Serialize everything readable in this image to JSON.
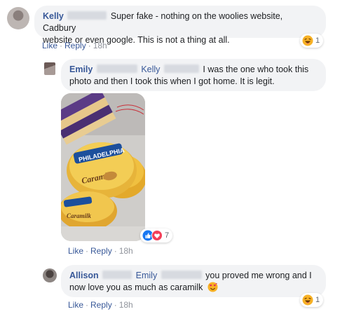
{
  "comments": [
    {
      "author": "Kelly",
      "text": "Super fake - nothing on the woolies website, Cadbury website or even google. This is not a thing at all.",
      "text_line1": "Super fake - nothing on the woolies website, Cadbury",
      "text_line2": "website or even google. This is not a thing at all.",
      "reaction": {
        "icon": "haha-emoji-icon",
        "count": "1"
      },
      "actions": {
        "like": "Like",
        "reply": "Reply",
        "time": "18h"
      }
    },
    {
      "author": "Emily",
      "mention": "Kelly",
      "text_line1": "I was the one who took this",
      "text_line2": "photo and then I took this when I got home. It is legit.",
      "photo_reactions": {
        "icons": [
          "like-icon",
          "love-icon"
        ],
        "count": "7"
      },
      "photo_label": "PHILADELPHIA Caramilk",
      "actions": {
        "like": "Like",
        "reply": "Reply",
        "time": "18h"
      }
    },
    {
      "author": "Allison",
      "mention": "Emily",
      "text_line1": "you proved me wrong and I",
      "text_line2": "now love you as much as caramilk",
      "emoji": "heart-eyes-face-icon",
      "reaction": {
        "icon": "haha-emoji-icon",
        "count": "1"
      },
      "actions": {
        "like": "Like",
        "reply": "Reply",
        "time": "18h"
      }
    }
  ],
  "colors": {
    "link": "#385898",
    "bubble": "#f2f3f5",
    "like_blue": "#1877f2",
    "love_red": "#f33e58",
    "haha_yellow": "#f7b125"
  }
}
